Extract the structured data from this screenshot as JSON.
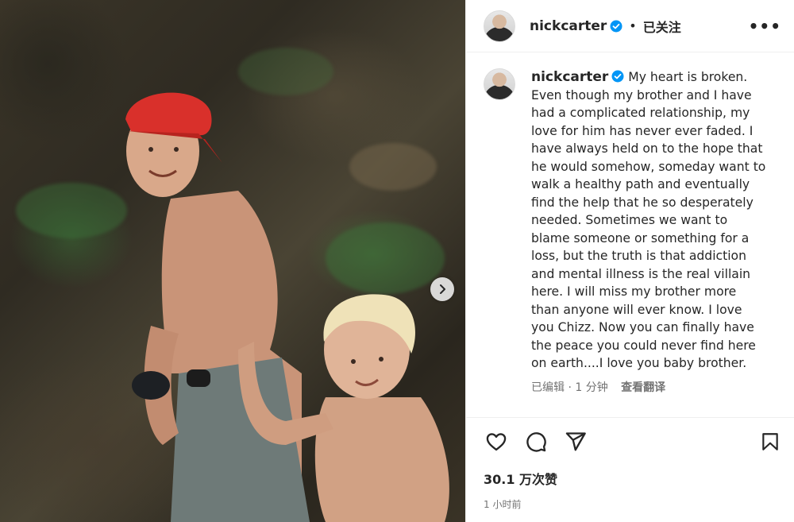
{
  "post": {
    "username": "nickcarter",
    "follow_state": "已关注",
    "more_label": "•••",
    "caption": "My heart is broken. Even though my brother and I have had a complicated relationship, my love for him has never ever faded. I have always held on to the hope that he would somehow, someday want to walk a healthy path and eventually find the help that he so desperately needed. Sometimes we want to blame someone or something for a loss, but the truth is that addiction and mental illness is the real villain here. I will miss my brother more than anyone will ever know. I love you Chizz. Now you can finally have the peace you could never find here on earth....I love you baby brother.",
    "edited_label": "已编辑",
    "caption_time": "1 分钟",
    "translate_label": "查看翻译",
    "likes": "30.1 万次赞",
    "posted_time": "1 小时前"
  },
  "icons": {
    "verified": "verified-badge-icon",
    "like": "heart-icon",
    "comment": "comment-icon",
    "share": "share-icon",
    "save": "bookmark-icon",
    "next": "chevron-right-icon"
  },
  "colors": {
    "verified_blue": "#0095f6",
    "text": "#262626",
    "secondary_text": "#737373",
    "cap_red": "#d9302b"
  }
}
